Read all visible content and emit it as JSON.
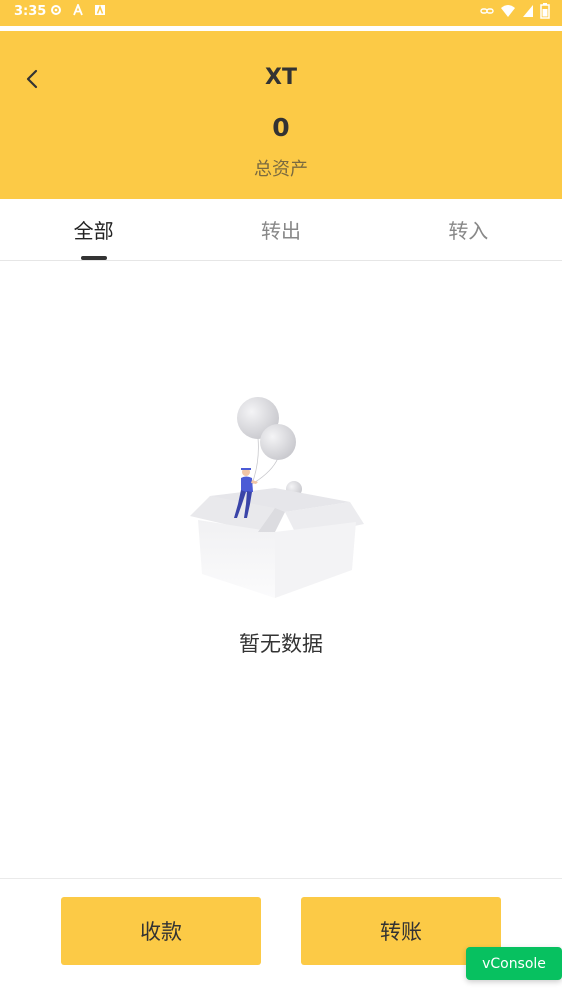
{
  "status_bar": {
    "time": "3:35",
    "left_icons": [
      "settings-icon",
      "a-letter-icon",
      "a-box-icon"
    ],
    "right_icons": [
      "link-icon",
      "wifi-icon",
      "signal-icon",
      "battery-icon"
    ]
  },
  "header": {
    "title": "XT",
    "total_value": "0",
    "total_label": "总资产",
    "back_icon": "chevron-left-icon"
  },
  "tabs": [
    {
      "label": "全部",
      "active": true
    },
    {
      "label": "转出",
      "active": false
    },
    {
      "label": "转入",
      "active": false
    }
  ],
  "empty_state": {
    "text": "暂无数据",
    "illustration": "empty-box-balloons-illustration"
  },
  "actions": {
    "receive_label": "收款",
    "transfer_label": "转账"
  },
  "vconsole": {
    "label": "vConsole"
  },
  "colors": {
    "primary": "#fcca46",
    "text": "#333333",
    "muted": "#888888",
    "vconsole": "#07c160"
  }
}
